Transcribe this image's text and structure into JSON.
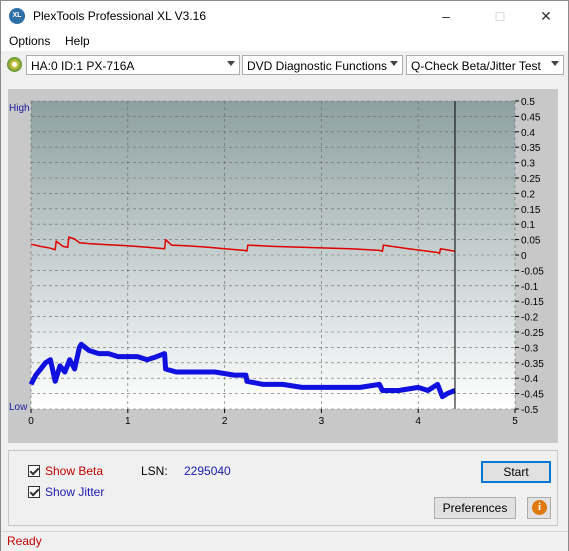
{
  "window": {
    "title": "PlexTools Professional XL V3.16",
    "app_icon_text": "XL"
  },
  "menu": {
    "options": "Options",
    "help": "Help"
  },
  "toolbar": {
    "drive": "HA:0 ID:1  PX-716A",
    "function": "DVD Diagnostic Functions",
    "test": "Q-Check Beta/Jitter Test"
  },
  "chart": {
    "left_high": "High",
    "left_low": "Low",
    "y_ticks": [
      "0.5",
      "0.45",
      "0.4",
      "0.35",
      "0.3",
      "0.25",
      "0.2",
      "0.15",
      "0.1",
      "0.05",
      "0",
      "-0.05",
      "-0.1",
      "-0.15",
      "-0.2",
      "-0.25",
      "-0.3",
      "-0.35",
      "-0.4",
      "-0.45",
      "-0.5"
    ],
    "x_ticks": [
      "0",
      "1",
      "2",
      "3",
      "4",
      "5"
    ],
    "colors": {
      "beta": "#e00000",
      "jitter": "#1010e0",
      "bg_top": "#8da0a0",
      "bg_bottom": "#ffffff"
    }
  },
  "chart_data": {
    "type": "line",
    "xlim": [
      0,
      5
    ],
    "ylim": [
      -0.5,
      0.5
    ],
    "x_ticks": [
      0,
      1,
      2,
      3,
      4,
      5
    ],
    "y_ticks": [
      0.5,
      0.45,
      0.4,
      0.35,
      0.3,
      0.25,
      0.2,
      0.15,
      0.1,
      0.05,
      0,
      -0.05,
      -0.1,
      -0.15,
      -0.2,
      -0.25,
      -0.3,
      -0.35,
      -0.4,
      -0.45,
      -0.5
    ],
    "grid": true,
    "end_marker_x": 4.38,
    "series": [
      {
        "color": "#e00000",
        "x": [
          0,
          0.1,
          0.2,
          0.25,
          0.26,
          0.33,
          0.38,
          0.39,
          0.45,
          0.5,
          0.6,
          0.8,
          1.0,
          1.2,
          1.38,
          1.39,
          1.45,
          1.6,
          1.8,
          2.0,
          2.2,
          2.23,
          2.24,
          2.5,
          2.8,
          3.0,
          3.3,
          3.6,
          3.63,
          3.64,
          3.9,
          4.1,
          4.2,
          4.22,
          4.23,
          4.38
        ],
        "y": [
          0.035,
          0.028,
          0.022,
          0.017,
          0.045,
          0.028,
          0.025,
          0.058,
          0.052,
          0.04,
          0.037,
          0.033,
          0.03,
          0.025,
          0.02,
          0.05,
          0.032,
          0.03,
          0.026,
          0.02,
          0.015,
          0.013,
          0.032,
          0.028,
          0.025,
          0.023,
          0.02,
          0.015,
          0.012,
          0.032,
          0.02,
          0.012,
          0.008,
          0.005,
          0.02,
          0.012
        ]
      },
      {
        "color": "#1010e0",
        "x": [
          0,
          0.05,
          0.1,
          0.15,
          0.2,
          0.25,
          0.3,
          0.35,
          0.4,
          0.45,
          0.5,
          0.52,
          0.6,
          0.7,
          0.8,
          0.9,
          1.0,
          1.1,
          1.2,
          1.3,
          1.38,
          1.39,
          1.5,
          1.7,
          1.9,
          2.1,
          2.22,
          2.23,
          2.4,
          2.6,
          2.8,
          3.0,
          3.2,
          3.4,
          3.6,
          3.63,
          3.64,
          3.8,
          4.0,
          4.1,
          4.2,
          4.25,
          4.3,
          4.38
        ],
        "y": [
          -0.42,
          -0.39,
          -0.37,
          -0.35,
          -0.34,
          -0.41,
          -0.36,
          -0.38,
          -0.34,
          -0.37,
          -0.3,
          -0.29,
          -0.31,
          -0.32,
          -0.32,
          -0.33,
          -0.33,
          -0.33,
          -0.34,
          -0.33,
          -0.32,
          -0.37,
          -0.38,
          -0.38,
          -0.38,
          -0.39,
          -0.39,
          -0.41,
          -0.42,
          -0.42,
          -0.43,
          -0.43,
          -0.43,
          -0.43,
          -0.42,
          -0.44,
          -0.44,
          -0.44,
          -0.43,
          -0.44,
          -0.42,
          -0.46,
          -0.45,
          -0.44
        ]
      }
    ]
  },
  "options_panel": {
    "show_beta": "Show Beta",
    "show_jitter": "Show Jitter",
    "lsn_label": "LSN:",
    "lsn_value": "2295040",
    "start": "Start",
    "preferences": "Preferences",
    "info_icon_text": "i"
  },
  "status": {
    "text": "Ready"
  }
}
